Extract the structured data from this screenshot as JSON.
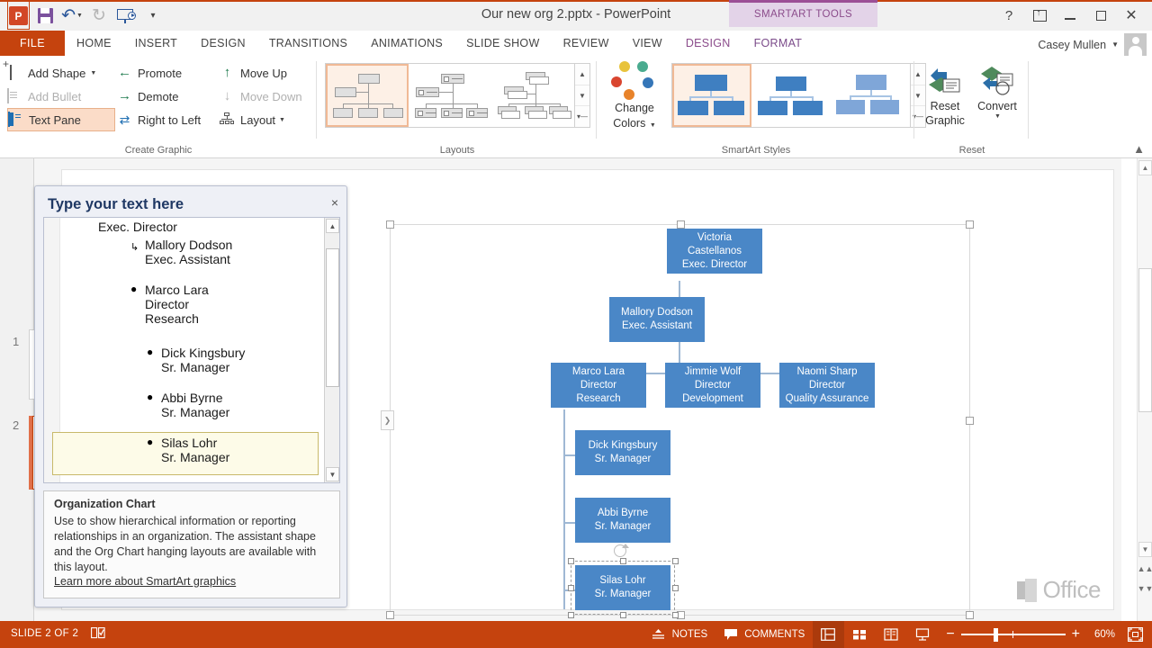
{
  "titlebar": {
    "document_title": "Our new org 2.pptx - PowerPoint",
    "contextual_tab_group": "SMARTART TOOLS",
    "user_name": "Casey Mullen",
    "qat": [
      {
        "name": "powerpoint-logo",
        "label": "P"
      },
      {
        "name": "save-icon",
        "label": "Save"
      },
      {
        "name": "undo-icon",
        "label": "Undo"
      },
      {
        "name": "redo-icon",
        "label": "Redo"
      },
      {
        "name": "start-slideshow-icon",
        "label": "Start From Beginning"
      },
      {
        "name": "customize-qat-icon",
        "label": "Customize Quick Access Toolbar"
      }
    ],
    "window_controls": [
      "help",
      "ribbon-display-options",
      "minimize",
      "restore",
      "close"
    ]
  },
  "tabs": [
    {
      "label": "FILE",
      "type": "file"
    },
    {
      "label": "HOME",
      "type": "normal"
    },
    {
      "label": "INSERT",
      "type": "normal"
    },
    {
      "label": "DESIGN",
      "type": "normal"
    },
    {
      "label": "TRANSITIONS",
      "type": "normal"
    },
    {
      "label": "ANIMATIONS",
      "type": "normal"
    },
    {
      "label": "SLIDE SHOW",
      "type": "normal"
    },
    {
      "label": "REVIEW",
      "type": "normal"
    },
    {
      "label": "VIEW",
      "type": "normal"
    },
    {
      "label": "DESIGN",
      "type": "contextual-active"
    },
    {
      "label": "FORMAT",
      "type": "contextual"
    }
  ],
  "ribbon": {
    "groups": [
      {
        "name": "create-graphic",
        "label": "Create Graphic"
      },
      {
        "name": "layouts",
        "label": "Layouts"
      },
      {
        "name": "smartart-styles",
        "label": "SmartArt Styles"
      },
      {
        "name": "reset",
        "label": "Reset"
      }
    ],
    "create_graphic": {
      "add_shape": "Add Shape",
      "add_bullet": "Add Bullet",
      "text_pane": "Text Pane",
      "promote": "Promote",
      "demote": "Demote",
      "right_to_left": "Right to Left",
      "move_up": "Move Up",
      "move_down": "Move Down",
      "layout": "Layout"
    },
    "change_colors": "Change\nColors",
    "change_colors_line1": "Change",
    "change_colors_line2": "Colors",
    "reset_graphic_line1": "Reset",
    "reset_graphic_line2": "Graphic",
    "convert": "Convert",
    "colors": {
      "accent_orange": "#c5430e",
      "node_blue": "#4a87c7",
      "contextual_purple": "#9c4f96",
      "highlight_peach": "#fbdcc8"
    }
  },
  "text_pane": {
    "title": "Type your text here",
    "close_label": "×",
    "entries": [
      {
        "name": "Exec. Director",
        "sub": "",
        "level": 1,
        "bullet": "none"
      },
      {
        "name": "Mallory Dodson",
        "sub": "Exec. Assistant",
        "level": 2,
        "bullet": "assistant"
      },
      {
        "name": "Marco Lara",
        "sub": "Director",
        "sub2": "Research",
        "level": 2,
        "bullet": "dot"
      },
      {
        "name": "Dick Kingsbury",
        "sub": "Sr. Manager",
        "level": 3,
        "bullet": "dot"
      },
      {
        "name": "Abbi Byrne",
        "sub": "Sr. Manager",
        "level": 3,
        "bullet": "dot"
      },
      {
        "name": "Silas Lohr",
        "sub": "Sr. Manager",
        "level": 3,
        "bullet": "dot",
        "selected": true
      }
    ],
    "description": {
      "title": "Organization Chart",
      "body": "Use to show hierarchical information or reporting relationships in an organization. The assistant shape and the Org Chart hanging layouts are available with this layout.",
      "link": "Learn more about SmartArt graphics"
    }
  },
  "slide_panel": {
    "thumbnails": [
      {
        "number": "1",
        "selected": false
      },
      {
        "number": "2",
        "selected": true
      }
    ]
  },
  "org_chart": {
    "nodes": [
      {
        "id": "n1",
        "lines": [
          "Victoria",
          "Castellanos",
          "Exec. Director"
        ],
        "selected": false
      },
      {
        "id": "n2",
        "lines": [
          "Mallory Dodson",
          "Exec. Assistant"
        ],
        "selected": false
      },
      {
        "id": "n3",
        "lines": [
          "Marco Lara",
          "Director",
          "Research"
        ],
        "selected": false
      },
      {
        "id": "n4",
        "lines": [
          "Jimmie Wolf",
          "Director",
          "Development"
        ],
        "selected": false
      },
      {
        "id": "n5",
        "lines": [
          "Naomi Sharp",
          "Director",
          "Quality Assurance"
        ],
        "selected": false
      },
      {
        "id": "n6",
        "lines": [
          "Dick Kingsbury",
          "Sr. Manager"
        ],
        "selected": false
      },
      {
        "id": "n7",
        "lines": [
          "Abbi Byrne",
          "Sr. Manager"
        ],
        "selected": false
      },
      {
        "id": "n8",
        "lines": [
          "Silas Lohr",
          "Sr. Manager"
        ],
        "selected": true
      }
    ]
  },
  "watermark": "Office",
  "statusbar": {
    "slide_indicator": "SLIDE 2 OF 2",
    "notes_label": "NOTES",
    "comments_label": "COMMENTS",
    "zoom_percent": "60%",
    "views": [
      "normal-view",
      "slide-sorter-view",
      "reading-view",
      "slide-show-view"
    ]
  }
}
